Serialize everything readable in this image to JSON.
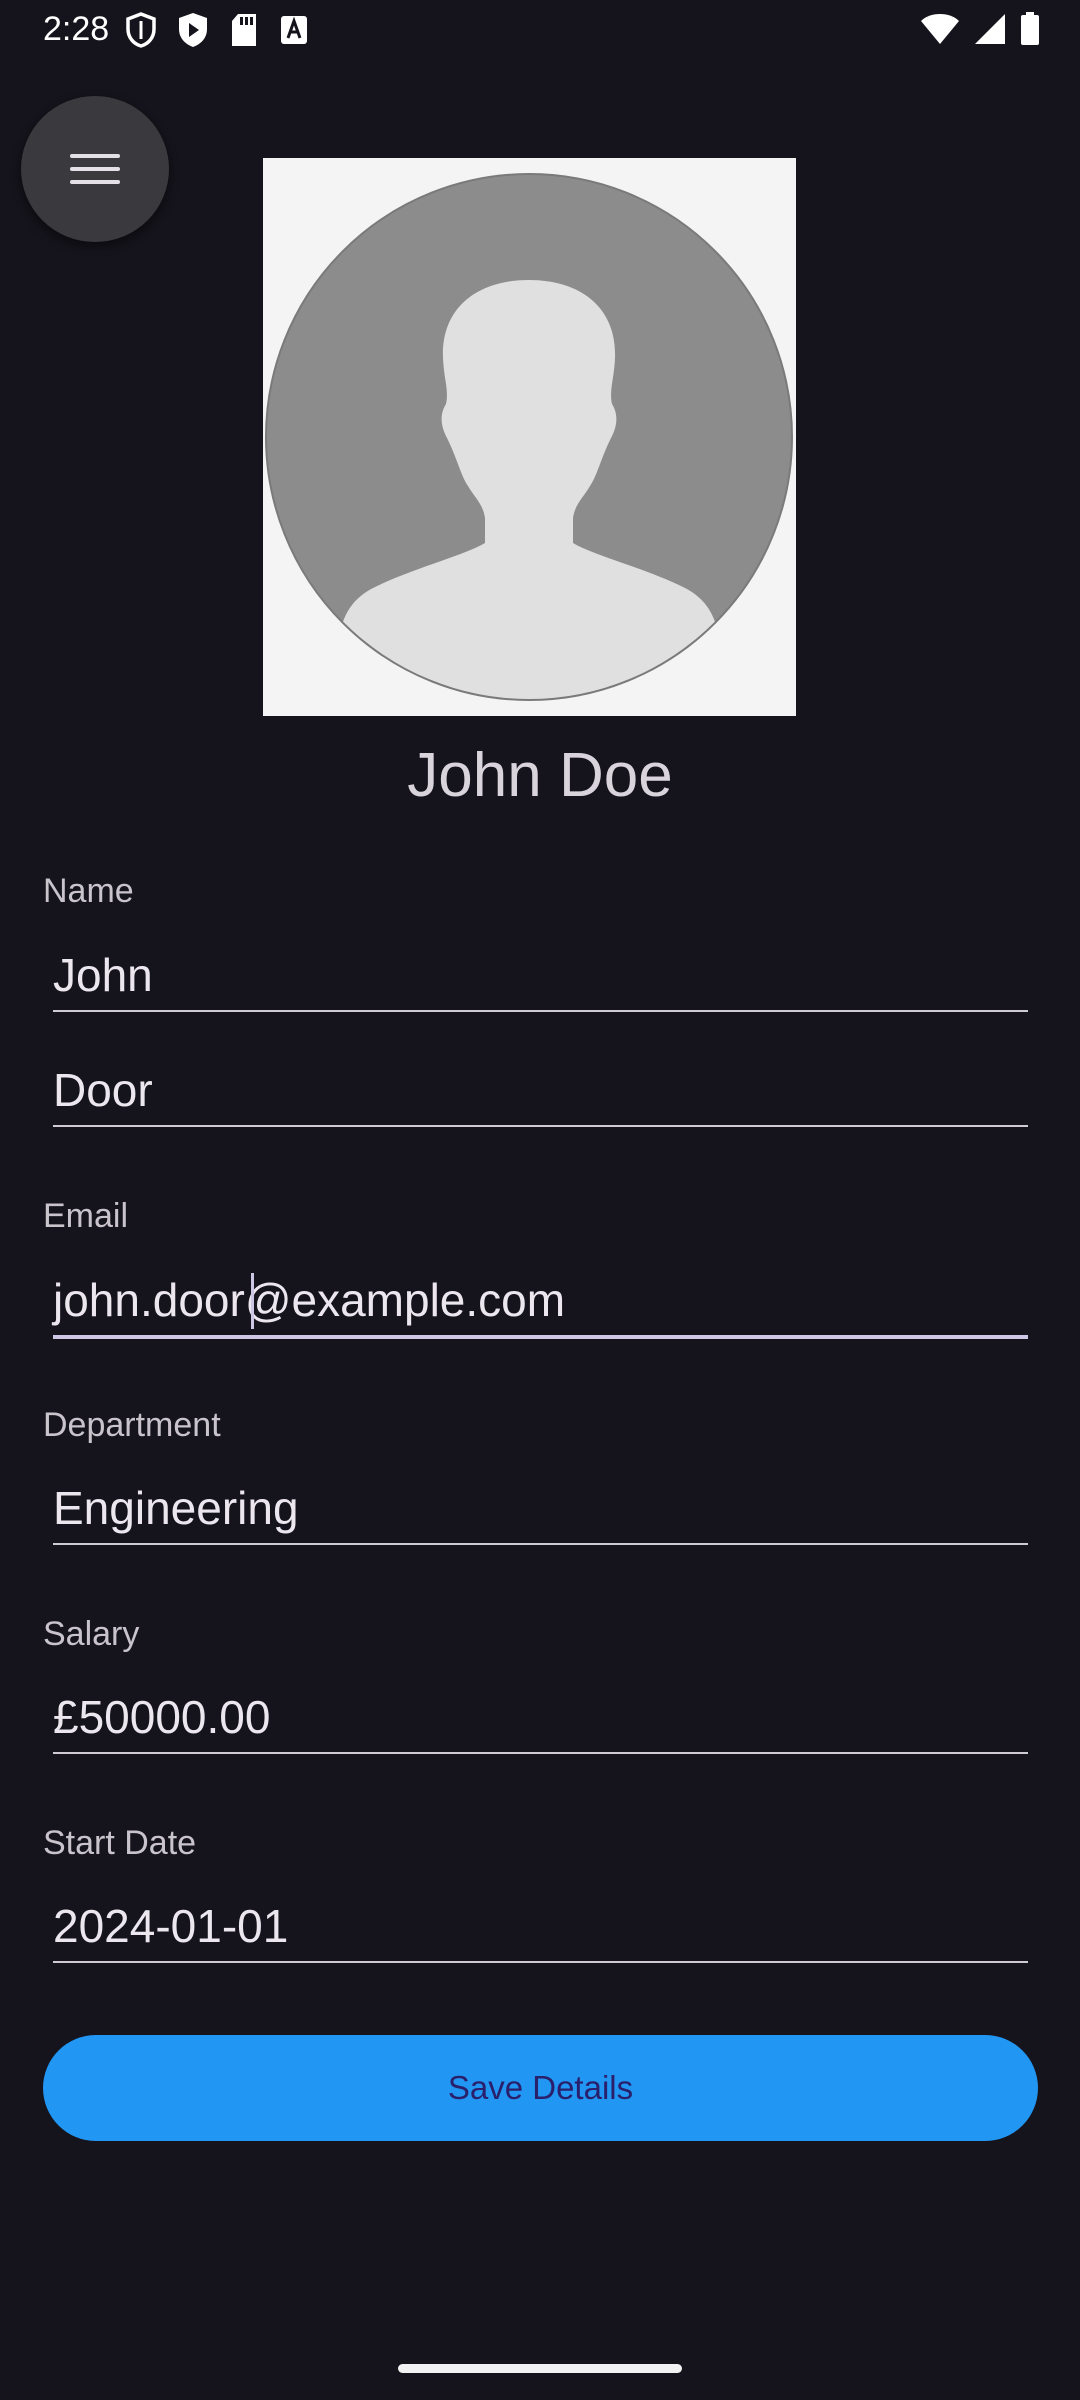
{
  "status_bar": {
    "time": "2:28",
    "left_icons": [
      "shield-icon",
      "play-protect-icon",
      "sd-card-icon",
      "text-a-icon"
    ],
    "right_icons": [
      "wifi-icon",
      "signal-icon",
      "battery-icon"
    ]
  },
  "menu": {
    "icon": "hamburger-menu-icon"
  },
  "profile": {
    "avatar_icon": "default-avatar-icon",
    "display_name": "John Doe"
  },
  "form": {
    "name_label": "Name",
    "first_name": "John",
    "last_name": "Door",
    "email_label": "Email",
    "email": "john.door@example.com",
    "department_label": "Department",
    "department": "Engineering",
    "salary_label": "Salary",
    "salary": "£50000.00",
    "start_date_label": "Start Date",
    "start_date": "2024-01-01",
    "save_label": "Save Details"
  },
  "colors": {
    "background": "#15131b",
    "accent_button": "#2196f3",
    "button_text": "#2a1f6b",
    "focused_underline": "#cdc6e4"
  }
}
